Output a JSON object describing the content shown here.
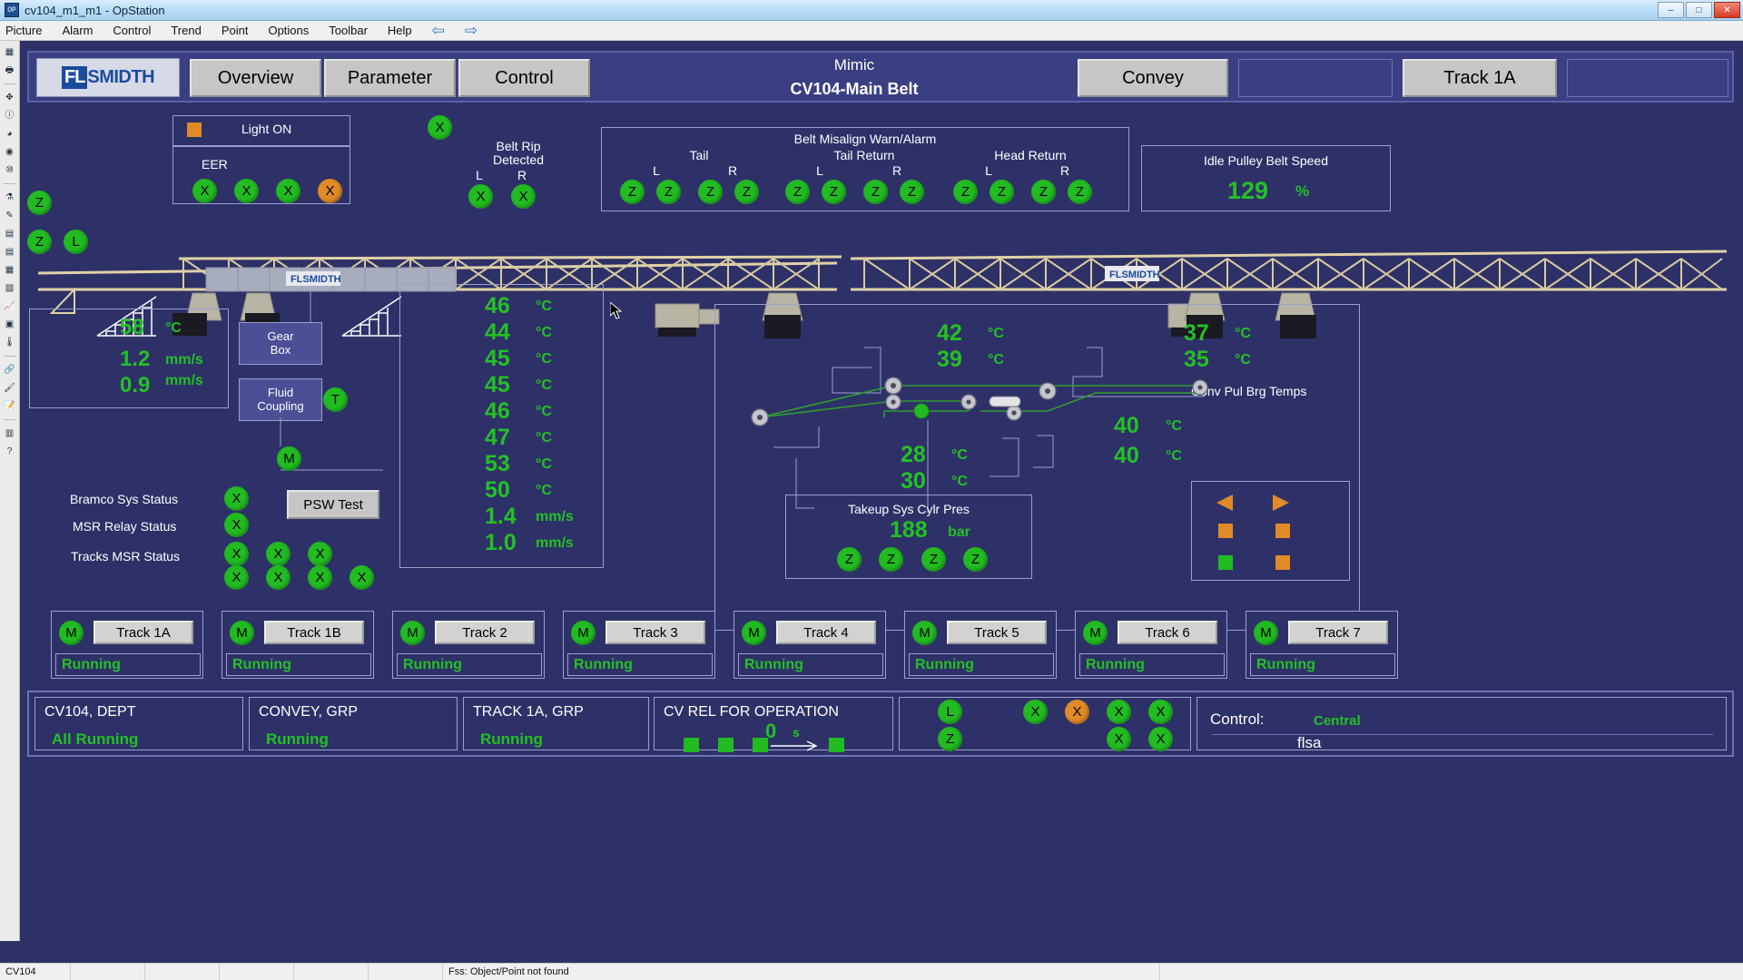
{
  "window": {
    "title": "cv104_m1_m1 - OpStation",
    "minimize": "–",
    "maximize": "□",
    "close": "✕"
  },
  "menu": {
    "items": [
      "Picture",
      "Alarm",
      "Control",
      "Trend",
      "Point",
      "Options",
      "Toolbar",
      "Help"
    ],
    "back_arrow": "⇦",
    "forward_arrow": "⇨"
  },
  "statusbar": {
    "cell1": "CV104",
    "cell2": "",
    "cell3": "",
    "cell4": "",
    "cell5": "",
    "cell6": "",
    "message": "Fss: Object/Point not found"
  },
  "header": {
    "logo_fl": "FL",
    "logo_smidth": "SMIDTH",
    "buttons": [
      "Overview",
      "Parameter",
      "Control"
    ],
    "mimic_label": "Mimic",
    "mimic_title": "CV104-Main Belt",
    "convey_button": "Convey",
    "track_button": "Track 1A"
  },
  "light_panel": {
    "light_label": "Light ON",
    "eer_label": "EER",
    "eer_indicators": [
      "X",
      "X",
      "X",
      "X"
    ],
    "eer_states": [
      "green",
      "green",
      "green",
      "orange"
    ]
  },
  "lone_indicator": "X",
  "belt_rip": {
    "title_line1": "Belt Rip",
    "title_line2": "Detected",
    "left_label": "L",
    "right_label": "R",
    "left_state": "X",
    "right_state": "X"
  },
  "belt_misalign": {
    "title": "Belt Misalign Warn/Alarm",
    "groups": [
      {
        "name": "Tail",
        "l_label": "L",
        "r_label": "R",
        "indicators": [
          "Z",
          "Z",
          "Z",
          "Z"
        ]
      },
      {
        "name": "Tail Return",
        "l_label": "L",
        "r_label": "R",
        "indicators": [
          "Z",
          "Z",
          "Z",
          "Z"
        ]
      },
      {
        "name": "Head Return",
        "l_label": "L",
        "r_label": "R",
        "indicators": [
          "Z",
          "Z",
          "Z",
          "Z"
        ]
      }
    ]
  },
  "idle_pulley": {
    "title": "Idle Pulley Belt Speed",
    "value": "129",
    "unit": "%"
  },
  "left_edge_indicators": [
    "Z",
    "Z",
    "L"
  ],
  "drive_panel": {
    "rows": [
      {
        "value": "58",
        "unit": "°C"
      },
      {
        "value": "1.2",
        "unit": "mm/s"
      },
      {
        "value": "0.9",
        "unit": "mm/s"
      }
    ]
  },
  "gearbox": {
    "line1": "Gear",
    "line2": "Box"
  },
  "fluid_coupling": {
    "line1": "Fluid",
    "line2": "Coupling",
    "indicator": "T"
  },
  "motor_indicator": "M",
  "center_temps": {
    "rows": [
      {
        "value": "46",
        "unit": "°C"
      },
      {
        "value": "44",
        "unit": "°C"
      },
      {
        "value": "45",
        "unit": "°C"
      },
      {
        "value": "45",
        "unit": "°C"
      },
      {
        "value": "46",
        "unit": "°C"
      },
      {
        "value": "47",
        "unit": "°C"
      },
      {
        "value": "53",
        "unit": "°C"
      },
      {
        "value": "50",
        "unit": "°C"
      },
      {
        "value": "1.4",
        "unit": "mm/s"
      },
      {
        "value": "1.0",
        "unit": "mm/s"
      }
    ]
  },
  "left_status": {
    "rows": [
      {
        "label": "Bramco Sys Status",
        "indicators": [
          "X"
        ]
      },
      {
        "label": "MSR Relay Status",
        "indicators": [
          "X"
        ]
      },
      {
        "label": "Tracks MSR Status",
        "indicators": [
          "X",
          "X",
          "X"
        ]
      }
    ],
    "extra_indicators": [
      "X",
      "X",
      "X",
      "X"
    ]
  },
  "psw_test_button": "PSW Test",
  "takeup": {
    "upper_temps": [
      {
        "value": "42",
        "unit": "°C"
      },
      {
        "value": "39",
        "unit": "°C"
      }
    ],
    "lower_temps": [
      {
        "value": "28",
        "unit": "°C"
      },
      {
        "value": "30",
        "unit": "°C"
      }
    ],
    "right_temps_top": [
      {
        "value": "37",
        "unit": "°C"
      },
      {
        "value": "35",
        "unit": "°C"
      }
    ],
    "conv_pul_label": "Conv Pul Brg Temps",
    "right_temps_bottom": [
      {
        "value": "40",
        "unit": "°C"
      },
      {
        "value": "40",
        "unit": "°C"
      }
    ],
    "cylr_title": "Takeup Sys Cylr Pres",
    "cylr_value": "188",
    "cylr_unit": "bar",
    "cylr_indicators": [
      "Z",
      "Z",
      "Z",
      "Z"
    ]
  },
  "tracks": [
    {
      "motor": "M",
      "label": "Track 1A",
      "status": "Running"
    },
    {
      "motor": "M",
      "label": "Track 1B",
      "status": "Running"
    },
    {
      "motor": "M",
      "label": "Track 2",
      "status": "Running"
    },
    {
      "motor": "M",
      "label": "Track 3",
      "status": "Running"
    },
    {
      "motor": "M",
      "label": "Track 4",
      "status": "Running"
    },
    {
      "motor": "M",
      "label": "Track 5",
      "status": "Running"
    },
    {
      "motor": "M",
      "label": "Track 6",
      "status": "Running"
    },
    {
      "motor": "M",
      "label": "Track 7",
      "status": "Running"
    }
  ],
  "bottom": {
    "dept": {
      "title": "CV104, DEPT",
      "value": "All Running"
    },
    "grp": {
      "title": "CONVEY, GRP",
      "value": "Running"
    },
    "track": {
      "title": "TRACK 1A, GRP",
      "value": "Running"
    },
    "release": {
      "title": "CV REL FOR OPERATION",
      "value": "0",
      "unit": "s"
    },
    "indicators_left": [
      "L",
      "Z"
    ],
    "indicators_row1": [
      "X",
      "X",
      "X",
      "X"
    ],
    "indicators_row1_states": [
      "green",
      "orange",
      "green",
      "green"
    ],
    "indicators_row2": [
      "X",
      "X"
    ],
    "control": {
      "label": "Control:",
      "mode": "Central",
      "user": "flsa"
    }
  },
  "colors": {
    "background": "#2e3168",
    "panel_border": "#9aa0cc",
    "green": "#24c024",
    "indicator_green": "#22bb22",
    "indicator_orange": "#e08a28",
    "header_bg": "#3a3f82",
    "brand_blue": "#1b4c9c",
    "steel": "#e0d2a8"
  }
}
